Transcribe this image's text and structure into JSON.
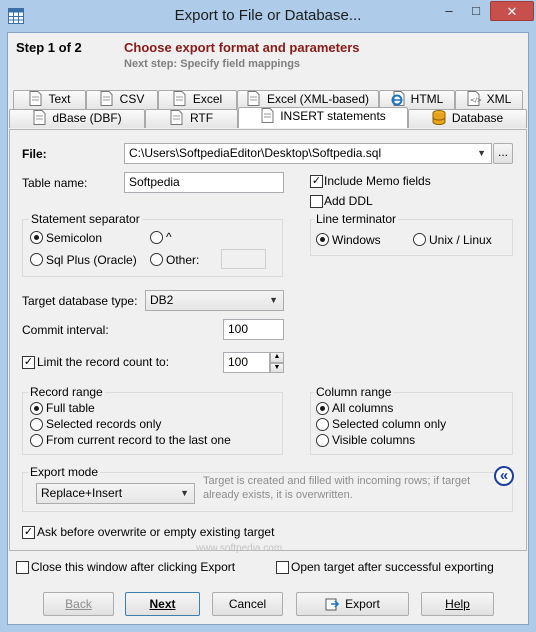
{
  "window": {
    "title": "Export to File or Database...",
    "min": "–",
    "max": "□",
    "close": "✕"
  },
  "header": {
    "step": "Step 1 of 2",
    "title": "Choose export format and parameters",
    "next_step": "Next step: Specify field mappings"
  },
  "tabs_row1": [
    "Text",
    "CSV",
    "Excel",
    "Excel (XML-based)",
    "HTML",
    "XML"
  ],
  "tabs_row2": [
    "dBase (DBF)",
    "RTF",
    "INSERT statements",
    "Database"
  ],
  "form": {
    "file_label": "File:",
    "file_value": "C:\\Users\\SoftpediaEditor\\Desktop\\Softpedia.sql",
    "browse_label": "...",
    "table_name_label": "Table name:",
    "table_name_value": "Softpedia",
    "include_memo_label": "Include Memo fields",
    "include_memo_checked": "✓",
    "add_ddl_label": "Add DDL",
    "statement_separator": {
      "title": "Statement separator",
      "semicolon": "Semicolon",
      "caret": "^",
      "sqlplus": "Sql Plus (Oracle)",
      "other": "Other:"
    },
    "line_terminator": {
      "title": "Line terminator",
      "windows": "Windows",
      "unix": "Unix / Linux"
    },
    "target_db_label": "Target database type:",
    "target_db_value": "DB2",
    "commit_label": "Commit interval:",
    "commit_value": "100",
    "limit_label": "Limit the record count to:",
    "limit_checked": "✓",
    "limit_value": "100",
    "record_range": {
      "title": "Record range",
      "full": "Full table",
      "selected": "Selected records only",
      "from_current": "From current record to the last one"
    },
    "column_range": {
      "title": "Column range",
      "all": "All columns",
      "selected": "Selected column only",
      "visible": "Visible columns"
    },
    "export_mode": {
      "title": "Export mode",
      "value": "Replace+Insert",
      "description": "Target is created and filled with incoming rows; if target already exists, it is overwritten."
    },
    "ask_before_label": "Ask before overwrite or empty existing target",
    "ask_before_checked": "✓",
    "collapse_icon": "«"
  },
  "footer": {
    "close_window_label": "Close this window after clicking Export",
    "open_target_label": "Open target after successful exporting",
    "watermark": "www.softpedia.com"
  },
  "buttons": {
    "back": "Back",
    "next": "Next",
    "cancel": "Cancel",
    "export": "Export",
    "help": "Help"
  },
  "colors": {
    "title_red": "#8b1a1a",
    "close_red": "#c7504d",
    "frame": "#aeccea"
  }
}
